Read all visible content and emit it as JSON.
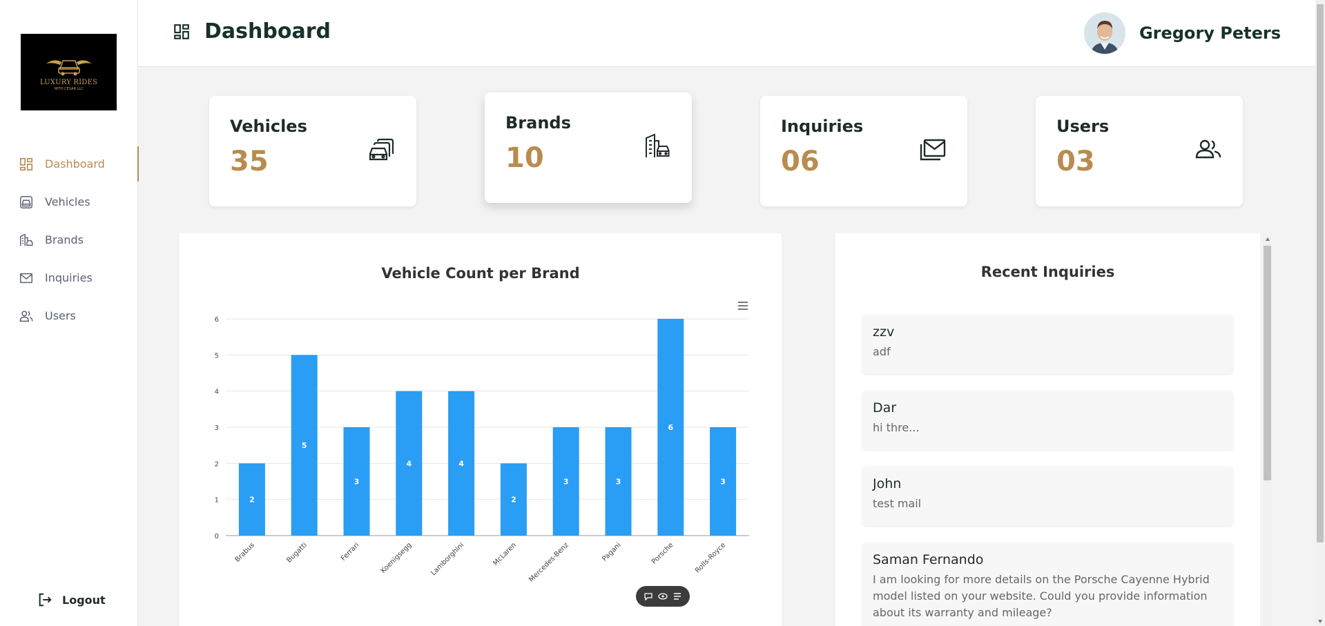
{
  "sidebar": {
    "logo": {
      "brand": "LUXURY RIDES",
      "sub": "WITH CESAR LLC"
    },
    "items": [
      {
        "label": "Dashboard",
        "icon": "dashboard-icon",
        "active": true
      },
      {
        "label": "Vehicles",
        "icon": "vehicle-icon",
        "active": false
      },
      {
        "label": "Brands",
        "icon": "building-icon",
        "active": false
      },
      {
        "label": "Inquiries",
        "icon": "mail-icon",
        "active": false
      },
      {
        "label": "Users",
        "icon": "users-icon",
        "active": false
      }
    ],
    "logout_label": "Logout"
  },
  "header": {
    "title": "Dashboard",
    "user_name": "Gregory Peters"
  },
  "stats": [
    {
      "label": "Vehicles",
      "value": "35",
      "icon": "cars-icon"
    },
    {
      "label": "Brands",
      "value": "10",
      "icon": "building-icon"
    },
    {
      "label": "Inquiries",
      "value": "06",
      "icon": "mail-icon"
    },
    {
      "label": "Users",
      "value": "03",
      "icon": "users-icon"
    }
  ],
  "colors": {
    "accent": "#b88c4f",
    "bar": "#2a9df4",
    "title": "#17312c"
  },
  "chart_data": {
    "type": "bar",
    "title": "Vehicle Count per Brand",
    "categories": [
      "Brabus",
      "Bugatti",
      "Ferrari",
      "Koenigsegg",
      "Lamborghini",
      "McLaren",
      "Mercedes-Benz",
      "Pagani",
      "Porsche",
      "Rolls-Royce"
    ],
    "values": [
      2,
      5,
      3,
      4,
      4,
      2,
      3,
      3,
      6,
      3
    ],
    "ylim": [
      0,
      6
    ],
    "yticks": [
      "0",
      "1",
      "2",
      "3",
      "4",
      "5",
      "6"
    ],
    "grid": true,
    "data_labels": true
  },
  "inquiries": {
    "title": "Recent Inquiries",
    "items": [
      {
        "name": "zzv",
        "message": "adf"
      },
      {
        "name": "Dar",
        "message": "hi thre..."
      },
      {
        "name": "John",
        "message": "test mail"
      },
      {
        "name": "Saman Fernando",
        "message": "I am looking for more details on the Porsche Cayenne Hybrid model listed on your website. Could you provide information about its warranty and mileage?"
      }
    ]
  }
}
